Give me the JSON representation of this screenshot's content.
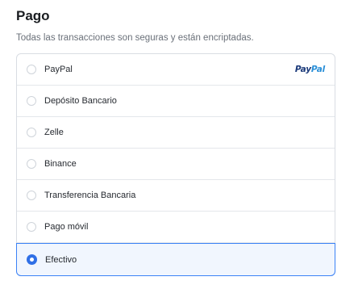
{
  "payment": {
    "title": "Pago",
    "subtitle": "Todas las transacciones son seguras y están encriptadas.",
    "options": [
      {
        "label": "PayPal",
        "logo": {
          "part1": "Pay",
          "part2": "Pal"
        },
        "selected": false
      },
      {
        "label": "Depósito Bancario",
        "selected": false
      },
      {
        "label": "Zelle",
        "selected": false
      },
      {
        "label": "Binance",
        "selected": false
      },
      {
        "label": "Transferencia Bancaria",
        "selected": false
      },
      {
        "label": "Pago móvil",
        "selected": false
      },
      {
        "label": "Efectivo",
        "selected": true
      }
    ],
    "colors": {
      "accent": "#2f6fe6",
      "selected_bg": "#f1f6fe",
      "paypal_dark": "#1b3a7a",
      "paypal_light": "#2a8fd8"
    }
  }
}
